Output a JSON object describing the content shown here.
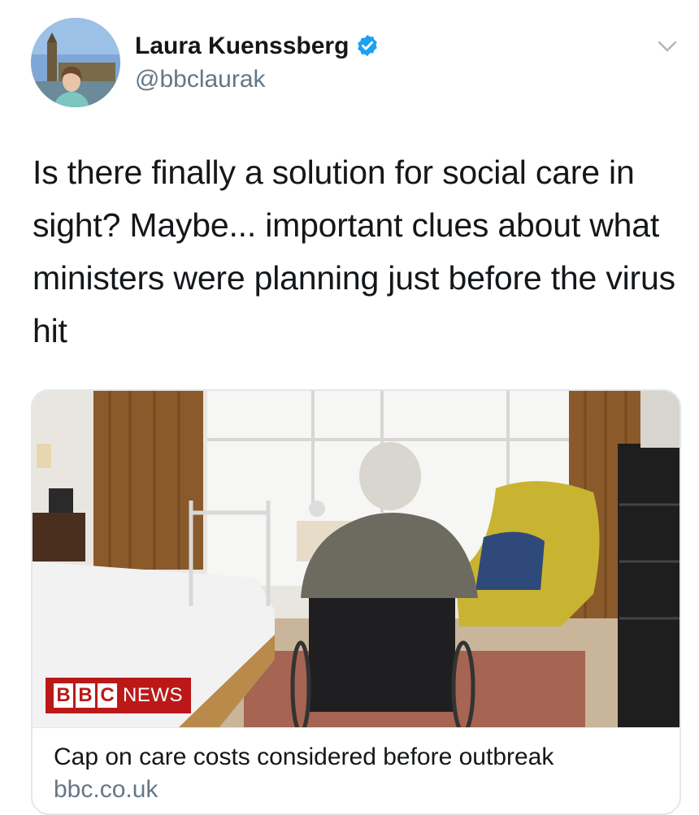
{
  "author": {
    "display_name": "Laura Kuenssberg",
    "handle": "@bbclaurak",
    "verified": true
  },
  "tweet": {
    "text": "Is there finally a solution for social care in sight? Maybe... important clues about what ministers were planning just before the virus hit"
  },
  "link_card": {
    "image_icon": "elderly-man-in-wheelchair-photo",
    "logo": {
      "letters": [
        "B",
        "B",
        "C"
      ],
      "suffix": "NEWS"
    },
    "title": "Cap on care costs considered before outbreak",
    "domain": "bbc.co.uk"
  },
  "icons": {
    "verified": "verified-badge-icon",
    "more": "chevron-down-icon"
  },
  "colors": {
    "verified_blue": "#1da1f2",
    "secondary_text": "#657786",
    "bbc_red": "#bb1919",
    "border": "#e1e8ed"
  }
}
